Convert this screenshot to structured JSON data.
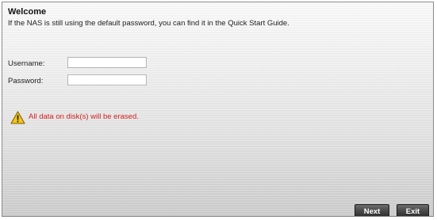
{
  "header": {
    "title": "Welcome",
    "message": "If the NAS is still using the default password, you can find it in the Quick Start Guide."
  },
  "form": {
    "username_label": "Username:",
    "username_value": "",
    "password_label": "Password:",
    "password_value": ""
  },
  "warning": {
    "icon": "warning-triangle-icon",
    "text": "All data on disk(s) will be erased.",
    "color": "#d42020"
  },
  "buttons": {
    "next_label": "Next",
    "exit_label": "Exit"
  }
}
